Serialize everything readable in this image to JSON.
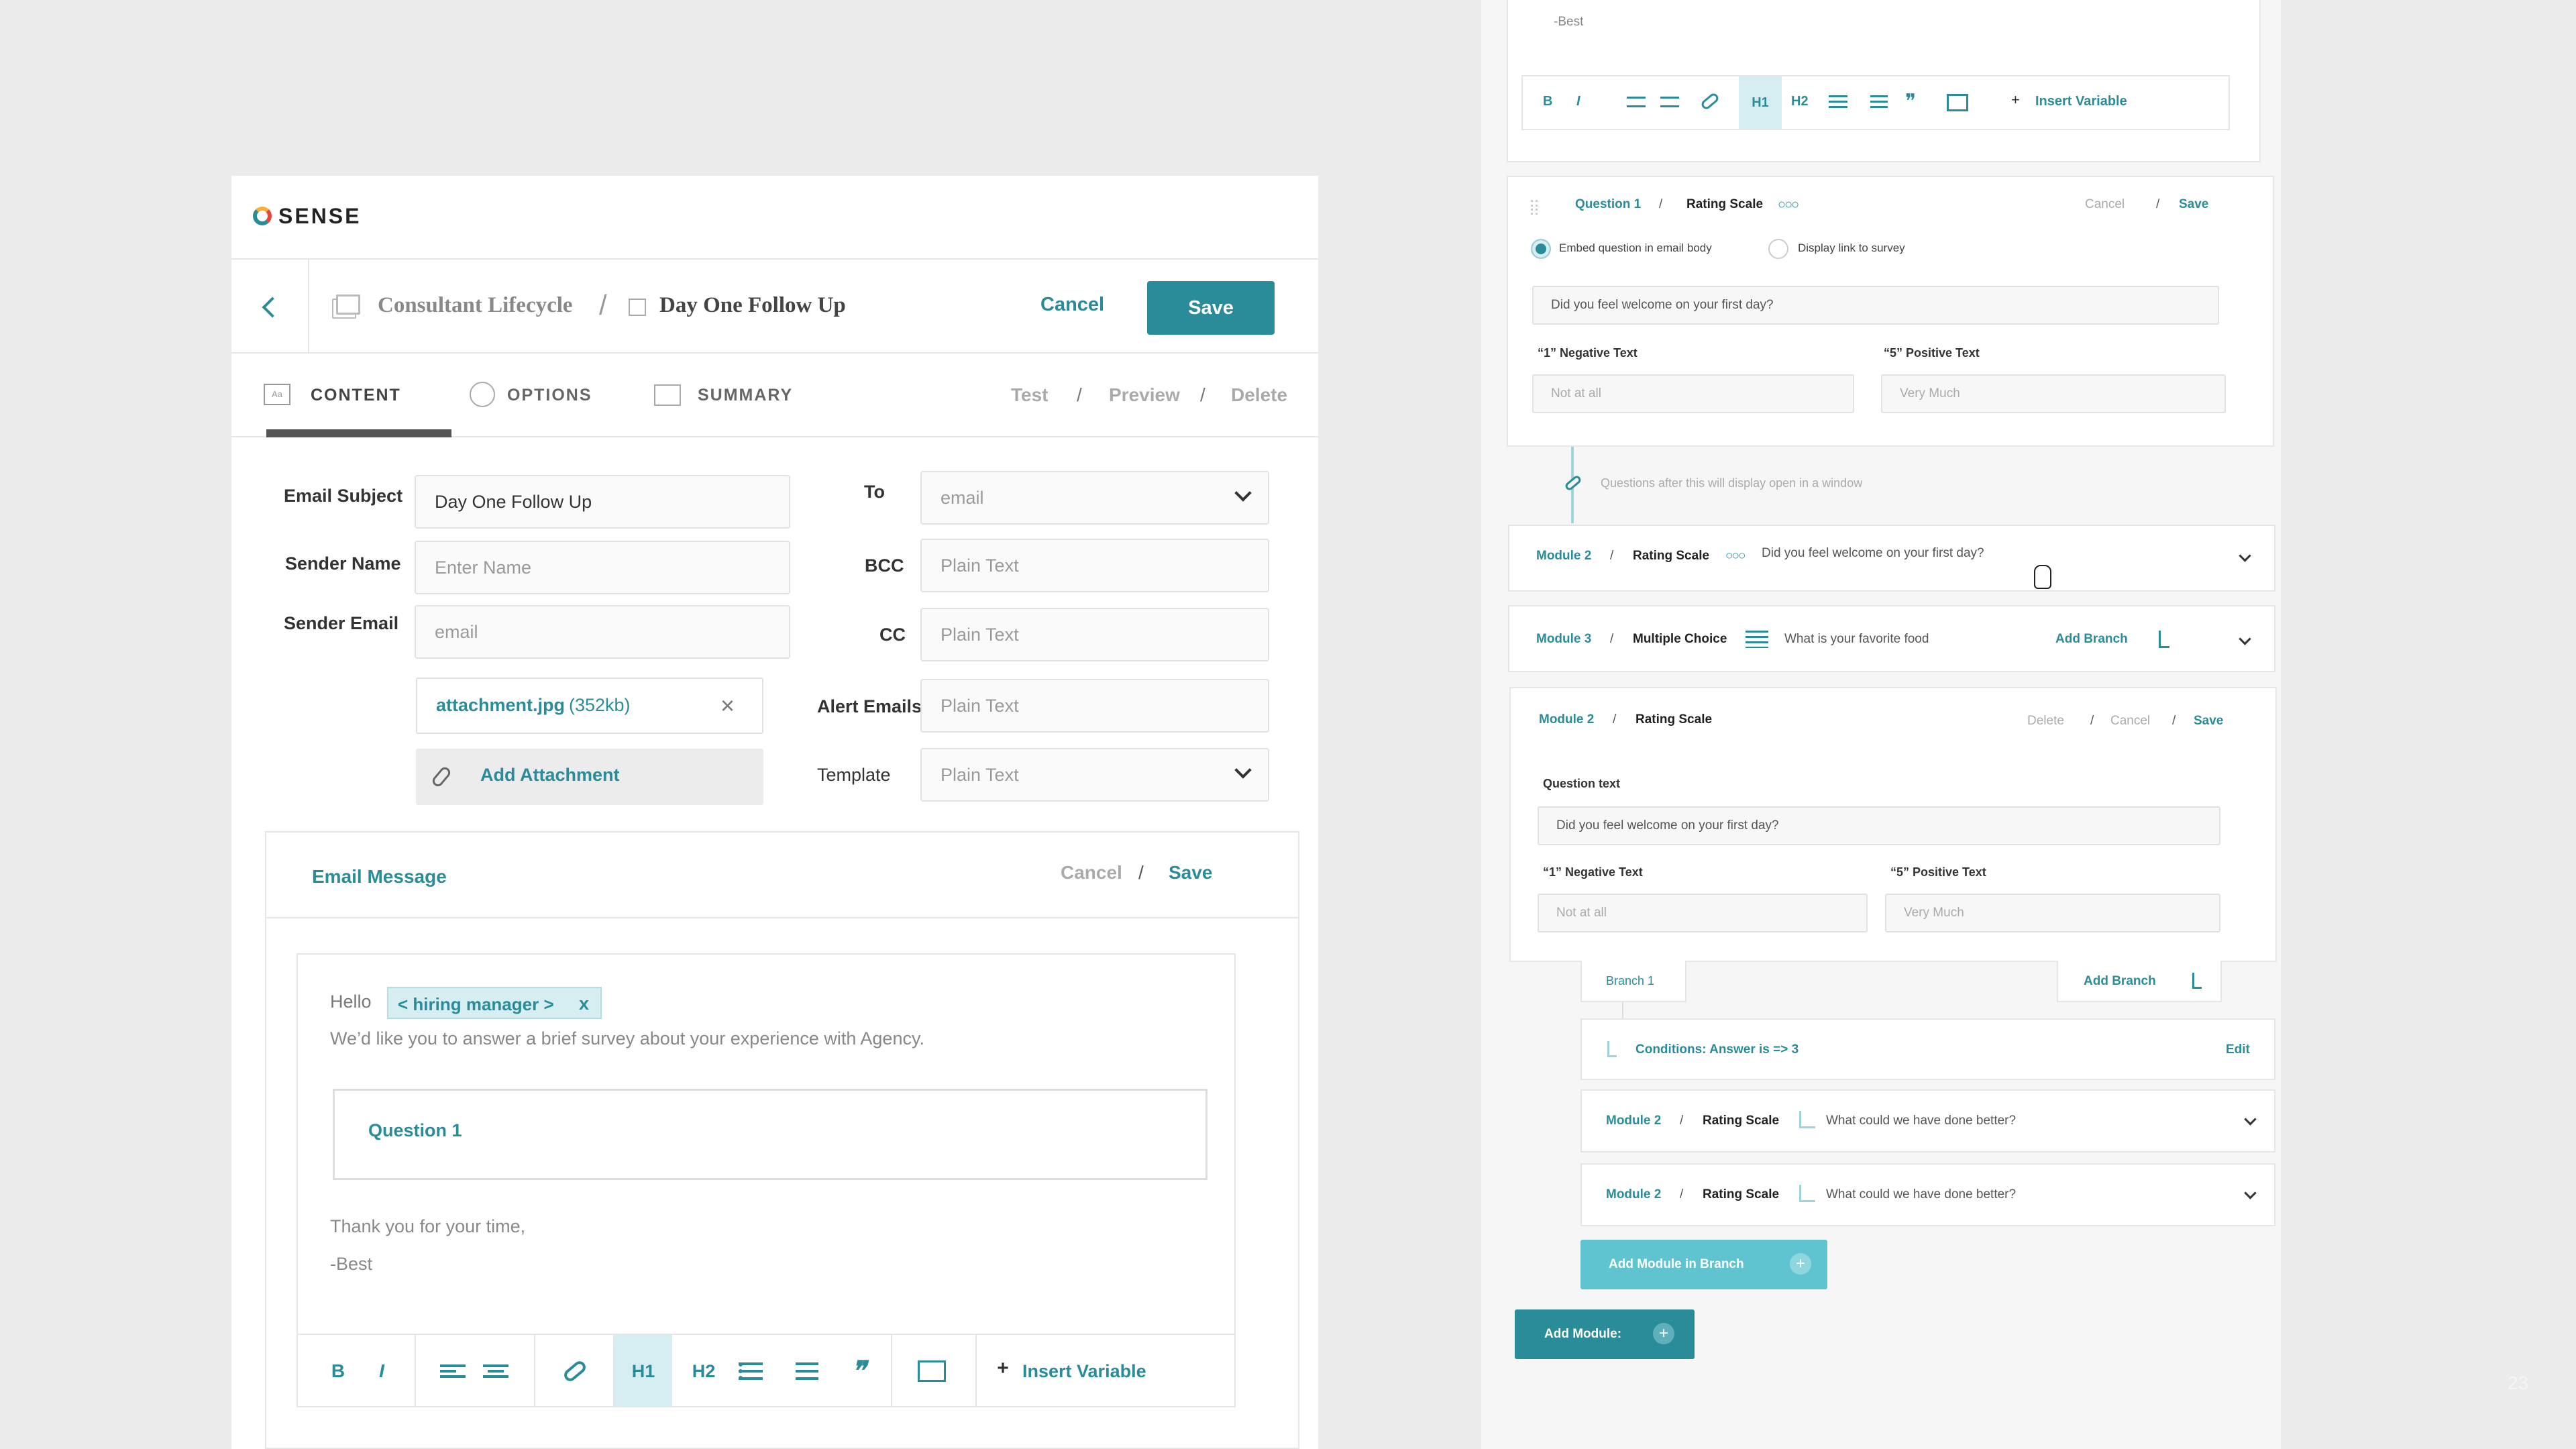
{
  "brand": {
    "name": "SENSE"
  },
  "header": {
    "breadcrumb_parent": "Consultant Lifecycle",
    "breadcrumb_sep": "/",
    "breadcrumb_current": "Day One Follow Up",
    "cancel_label": "Cancel",
    "save_label": "Save"
  },
  "tabs": [
    {
      "label": "CONTENT",
      "icon": "text-format-icon",
      "active": true
    },
    {
      "label": "OPTIONS",
      "icon": "target-icon",
      "active": false
    },
    {
      "label": "SUMMARY",
      "icon": "image-icon",
      "active": false
    }
  ],
  "tab_actions": {
    "test": "Test",
    "preview": "Preview",
    "delete": "Delete",
    "sep": "/"
  },
  "form": {
    "email_subject_label": "Email Subject",
    "email_subject_value": "Day One Follow Up",
    "sender_name_label": "Sender Name",
    "sender_name_placeholder": "Enter Name",
    "sender_email_label": "Sender Email",
    "sender_email_placeholder": "email",
    "to_label": "To",
    "to_value": "email",
    "bcc_label": "BCC",
    "bcc_placeholder": "Plain Text",
    "cc_label": "CC",
    "cc_placeholder": "Plain Text",
    "alert_label": "Alert Emails",
    "alert_placeholder": "Plain Text",
    "template_label": "Template",
    "template_value": "Plain Text",
    "attachment_name": "attachment.jpg",
    "attachment_size": "(352kb)",
    "add_attachment_label": "Add Attachment"
  },
  "email_message": {
    "title": "Email Message",
    "cancel_label": "Cancel",
    "sep": "/",
    "save_label": "Save",
    "greeting": "Hello",
    "variable_tag": "< hiring manager >",
    "variable_remove": "x",
    "intro": "We’d like you to answer a brief survey about your experience with Agency.",
    "question_block": "Question 1",
    "closing": "Thank you for your time,",
    "signoff": "-Best"
  },
  "toolbar": {
    "bold": "B",
    "italic": "I",
    "h1": "H1",
    "h2": "H2",
    "insert_plus": "+",
    "insert_variable": "Insert Variable"
  },
  "right": {
    "top_signoff": "-Best",
    "q1": {
      "title": "Question 1",
      "sep": "/",
      "type": "Rating Scale",
      "cancel": "Cancel",
      "save": "Save",
      "radio_embed": "Embed question in email body",
      "radio_link": "Display link to survey",
      "question_value": "Did you feel welcome on your first day?",
      "neg_label": "“1” Negative Text",
      "neg_placeholder": "Not at all",
      "pos_label": "“5” Positive Text",
      "pos_placeholder": "Very Much"
    },
    "window_note": "Questions after this will display open in a window",
    "module_a": {
      "name": "Module 2",
      "sep": "/",
      "type": "Rating Scale",
      "question": "Did you feel welcome on your first day?"
    },
    "module_b": {
      "name": "Module 3",
      "sep": "/",
      "type": "Multiple Choice",
      "question": "What is your favorite food",
      "add_branch": "Add Branch"
    },
    "module_c": {
      "name": "Module 2",
      "sep": "/",
      "type": "Rating Scale",
      "delete": "Delete",
      "cancel": "Cancel",
      "save": "Save",
      "question_label": "Question text",
      "question_value": "Did you feel welcome on your first day?",
      "neg_label": "“1” Negative Text",
      "neg_placeholder": "Not at all",
      "pos_label": "“5” Positive Text",
      "pos_placeholder": "Very Much"
    },
    "branch": {
      "label": "Branch 1",
      "add_branch": "Add Branch"
    },
    "conditions": {
      "text": "Conditions:  Answer is => 3",
      "edit": "Edit"
    },
    "branch_modules": [
      {
        "name": "Module 2",
        "sep": "/",
        "type": "Rating Scale",
        "question": "What could we have done better?"
      },
      {
        "name": "Module 2",
        "sep": "/",
        "type": "Rating Scale",
        "question": "What could we have done better?"
      }
    ],
    "add_module_branch": "Add Module in Branch",
    "add_module": "Add Module:",
    "add_plus": "+"
  },
  "page_number": "23",
  "colors": {
    "accent": "#2a8c99",
    "accent_light": "#d6eef1",
    "background": "#ebebeb"
  }
}
